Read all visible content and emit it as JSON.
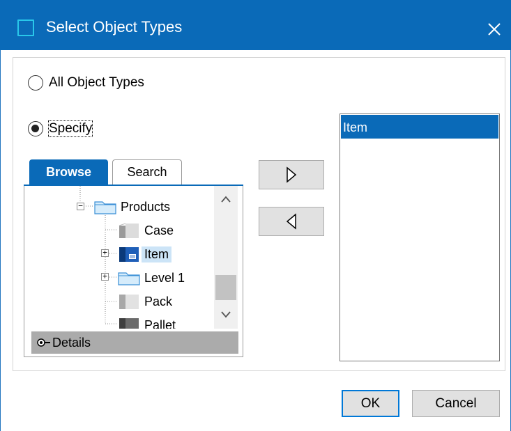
{
  "window": {
    "title": "Select Object Types",
    "title_icon": "window-icon",
    "close_icon": "close-icon"
  },
  "options": {
    "all_types_label": "All Object Types",
    "specify_label": "Specify",
    "selected": "specify"
  },
  "tabs": [
    {
      "label": "Browse",
      "active": true
    },
    {
      "label": "Search",
      "active": false
    }
  ],
  "tree": {
    "nodes": [
      {
        "label": "Products",
        "icon": "folder-icon",
        "expander": "collapse"
      },
      {
        "label": "Case",
        "icon": "case-icon"
      },
      {
        "label": "Item",
        "icon": "item-icon",
        "expander": "expand",
        "selected": true
      },
      {
        "label": "Level 1",
        "icon": "folder-icon",
        "expander": "expand"
      },
      {
        "label": "Pack",
        "icon": "pack-icon"
      },
      {
        "label": "Pallet",
        "icon": "pallet-icon"
      }
    ],
    "details_label": "Details",
    "details_icon": "expand-details-icon"
  },
  "transfer": {
    "add_icon": "right-triangle-icon",
    "remove_icon": "left-triangle-icon"
  },
  "selected_list": {
    "items": [
      "Item"
    ]
  },
  "buttons": {
    "ok_label": "OK",
    "cancel_label": "Cancel"
  },
  "colors": {
    "titlebar": "#0a6ab8",
    "selection": "#0a6ab8",
    "tree_selection": "#cce4f7"
  }
}
